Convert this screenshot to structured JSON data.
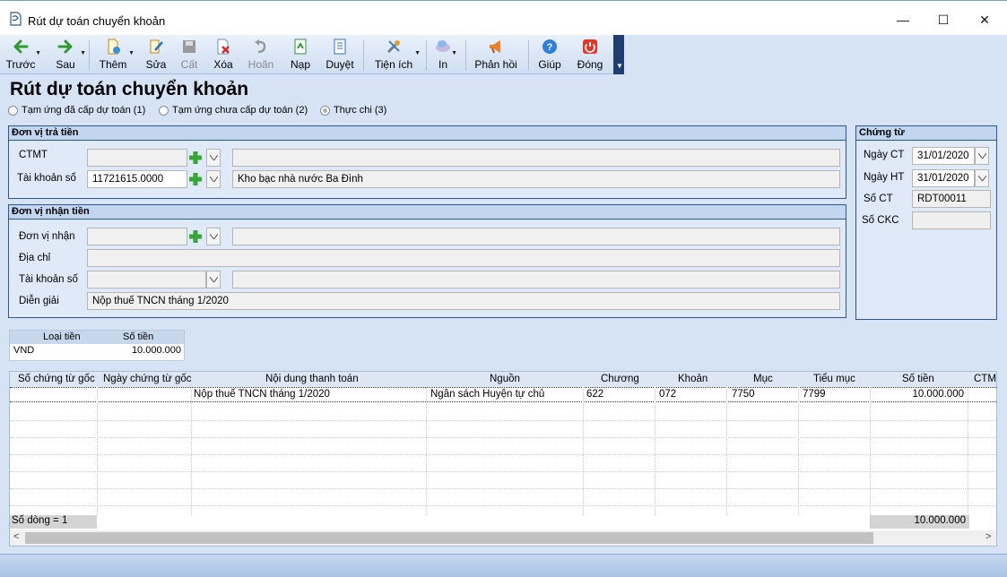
{
  "window": {
    "title": "Rút dự toán chuyển khoản",
    "minimize": "—",
    "maximize": "☐",
    "close": "✕"
  },
  "toolbar": [
    {
      "id": "back",
      "label": "Trước",
      "icon": "arrow-left-icon",
      "enabled": true
    },
    {
      "id": "next",
      "label": "Sau",
      "icon": "arrow-right-icon",
      "enabled": true
    },
    {
      "id": "add",
      "label": "Thêm",
      "icon": "add-document-icon",
      "enabled": true
    },
    {
      "id": "edit",
      "label": "Sửa",
      "icon": "edit-icon",
      "enabled": true
    },
    {
      "id": "save",
      "label": "Cất",
      "icon": "save-icon",
      "enabled": false
    },
    {
      "id": "delete",
      "label": "Xóa",
      "icon": "delete-icon",
      "enabled": true
    },
    {
      "id": "undo",
      "label": "Hoãn",
      "icon": "undo-icon",
      "enabled": false
    },
    {
      "id": "load",
      "label": "Nạp",
      "icon": "load-icon",
      "enabled": true
    },
    {
      "id": "approve",
      "label": "Duyệt",
      "icon": "approve-icon",
      "enabled": true
    },
    {
      "id": "utility",
      "label": "Tiện ích",
      "icon": "tools-icon",
      "enabled": true
    },
    {
      "id": "print",
      "label": "In",
      "icon": "print-icon",
      "enabled": true
    },
    {
      "id": "feedback",
      "label": "Phản hồi",
      "icon": "megaphone-icon",
      "enabled": true
    },
    {
      "id": "help",
      "label": "Giúp",
      "icon": "help-icon",
      "enabled": true
    },
    {
      "id": "close",
      "label": "Đóng",
      "icon": "power-icon",
      "enabled": true
    }
  ],
  "page": {
    "heading": "Rút dự toán chuyển khoản"
  },
  "radio_options": [
    {
      "label": "Tạm ứng đã cấp dự toán (1)",
      "selected": false
    },
    {
      "label": "Tạm ứng chưa cấp dự toán (2)",
      "selected": false
    },
    {
      "label": "Thực chi (3)",
      "selected": true
    }
  ],
  "payer": {
    "title": "Đơn vị trả tiền",
    "ctmt_label": "CTMT",
    "ctmt_value": "",
    "ctmt_desc": "",
    "account_label": "Tài khoản số",
    "account_value": "11721615.0000",
    "account_desc": "Kho bạc nhà nước Ba Đình"
  },
  "payee": {
    "title": "Đơn vị nhận tiền",
    "unit_label": "Đơn vị nhận",
    "unit_value": "",
    "unit_desc": "",
    "address_label": "Địa chỉ",
    "address_value": "",
    "account_label": "Tài khoản số",
    "account_value": "",
    "account_desc": "",
    "memo_label": "Diễn giải",
    "memo_value": "Nộp thuế TNCN tháng 1/2020"
  },
  "voucher": {
    "title": "Chứng từ",
    "voucher_date_label": "Ngày CT",
    "voucher_date": "31/01/2020",
    "posting_date_label": "Ngày HT",
    "posting_date": "31/01/2020",
    "voucher_no_label": "Số CT",
    "voucher_no": "RDT00011",
    "ckc_label": "Số CKC",
    "ckc_value": ""
  },
  "currency_table": {
    "headers": [
      "Loại tiền",
      "Số tiền"
    ],
    "row": {
      "currency": "VND",
      "amount": "10.000.000"
    }
  },
  "detail_grid": {
    "headers": [
      "Số chứng từ gốc",
      "Ngày chứng từ gốc",
      "Nội dung thanh toán",
      "Nguồn",
      "Chương",
      "Khoản",
      "Mục",
      "Tiểu mục",
      "Số tiền",
      "CTMT"
    ],
    "rows": [
      {
        "doc_no": "",
        "doc_date": "",
        "content": "Nộp thuế TNCN tháng 1/2020",
        "source": "Ngân sách Huyện tự chủ",
        "chapter": "622",
        "item": "072",
        "section": "7750",
        "subsection": "7799",
        "amount": "10.000.000",
        "ctmt": ""
      }
    ],
    "footer_count": "Số dòng = 1",
    "footer_total": "10.000.000"
  }
}
